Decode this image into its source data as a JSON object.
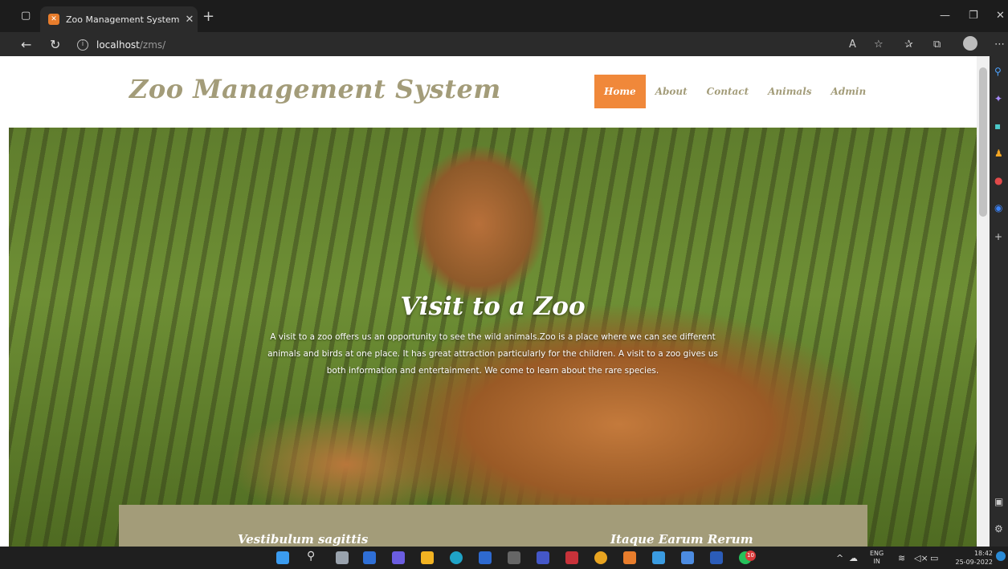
{
  "browser": {
    "tab_title": "Zoo Management System | Hom",
    "tab_close": "✕",
    "new_tab": "+",
    "url_host": "localhost",
    "url_path": "/zms/"
  },
  "site": {
    "brand": "Zoo Management System",
    "menu": [
      "Home",
      "About",
      "Contact",
      "Animals",
      "Admin"
    ],
    "active_menu": "Home",
    "hero_title": "Visit to a Zoo",
    "hero_desc": "A visit to a zoo offers us an opportunity to see the wild animals.Zoo is a place where we can see different animals and birds at one place. It has great attraction particularly for the children. A visit to a zoo gives us both information and entertainment. We come to learn about the rare species.",
    "panel_left_title": "Vestibulum sagittis",
    "panel_right_title": "Itaque Earum Rerum"
  },
  "taskbar": {
    "language_line1": "ENG",
    "language_line2": "IN",
    "time": "18:42",
    "date": "25-09-2022",
    "notification_count": "10"
  },
  "colors": {
    "brand": "#a39c79",
    "accent": "#f0883a"
  }
}
